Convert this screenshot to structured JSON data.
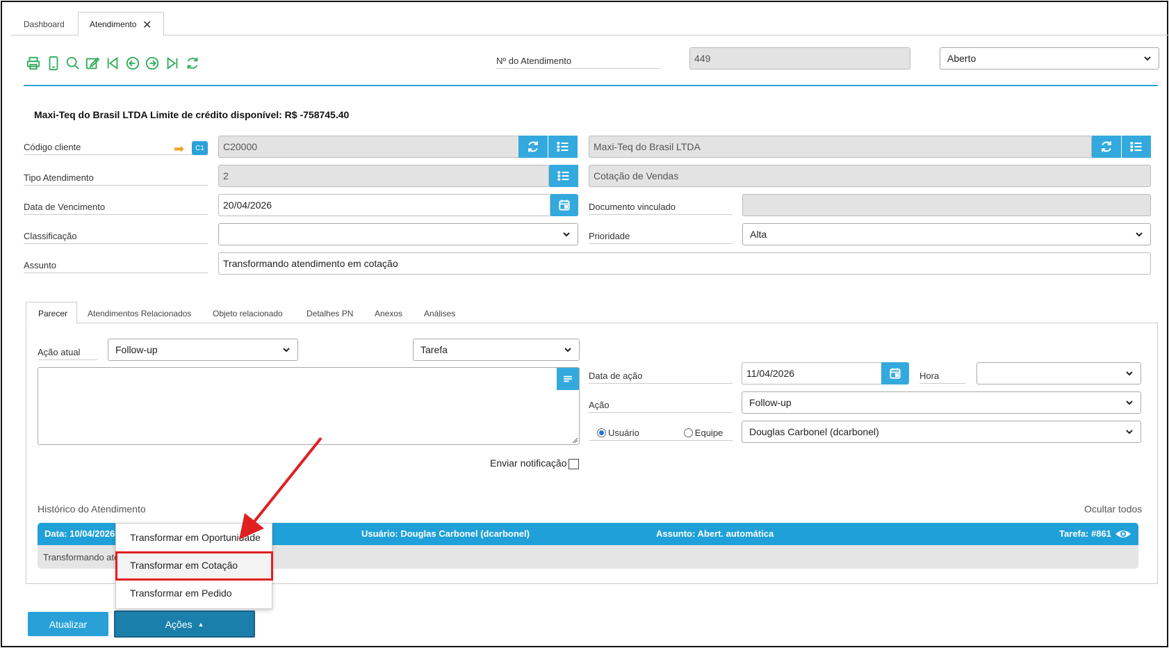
{
  "tabs": [
    {
      "label": "Dashboard"
    },
    {
      "label": "Atendimento"
    }
  ],
  "header": {
    "number_label": "Nº do Atendimento",
    "number_value": "449",
    "status_value": "Aberto"
  },
  "client_banner": "Maxi-Teq do Brasil LTDA Limite de crédito disponível: R$ -758745.40",
  "form": {
    "codigo_cliente_label": "Código cliente",
    "codigo_badge": "C1",
    "codigo_value": "C20000",
    "cliente_nome": "Maxi-Teq do Brasil LTDA",
    "tipo_label": "Tipo Atendimento",
    "tipo_value": "2",
    "tipo_desc": "Cotação de Vendas",
    "vencimento_label": "Data de Vencimento",
    "vencimento_value": "20/04/2026",
    "documento_label": "Documento vinculado",
    "documento_value": "",
    "classificacao_label": "Classificação",
    "classificacao_value": "",
    "prioridade_label": "Prioridade",
    "prioridade_value": "Alta",
    "assunto_label": "Assunto",
    "assunto_value": "Transformando atendimento em cotação"
  },
  "subtabs": [
    {
      "label": "Parecer"
    },
    {
      "label": "Atendimentos Relacionados"
    },
    {
      "label": "Objeto relacionado"
    },
    {
      "label": "Detalhes PN"
    },
    {
      "label": "Anexos"
    },
    {
      "label": "Análises"
    }
  ],
  "parecer": {
    "acao_atual_label": "Ação atual",
    "acao_atual_value": "Follow-up",
    "tipo_value": "Tarefa",
    "data_acao_label": "Data de ação",
    "data_acao_value": "11/04/2026",
    "hora_label": "Hora",
    "hora_value": "",
    "acao_label": "Ação",
    "acao_value": "Follow-up",
    "radio_usuario": "Usuário",
    "radio_equipe": "Equipe",
    "responsavel_value": "Douglas Carbonel (dcarbonel)",
    "notificacao_label": "Enviar notificação"
  },
  "historico": {
    "title": "Histórico do Atendimento",
    "hide_all": "Ocultar todos",
    "data": "Data: 10/04/2026",
    "usuario": "Usuário: Douglas Carbonel (dcarbonel)",
    "assunto": "Assunto: Abert. automática",
    "tarefa": "Tarefa: #861",
    "body": "Transformando atendimento em cotação"
  },
  "menu": {
    "items": [
      {
        "label": "Transformar em Oportunidade"
      },
      {
        "label": "Transformar em Cotação"
      },
      {
        "label": "Transformar em Pedido"
      }
    ]
  },
  "buttons": {
    "atualizar": "Atualizar",
    "acoes": "Ações"
  },
  "colors": {
    "accent": "#33a9dd",
    "toolbar_green": "#2eab58",
    "highlight_red": "#e02020"
  }
}
